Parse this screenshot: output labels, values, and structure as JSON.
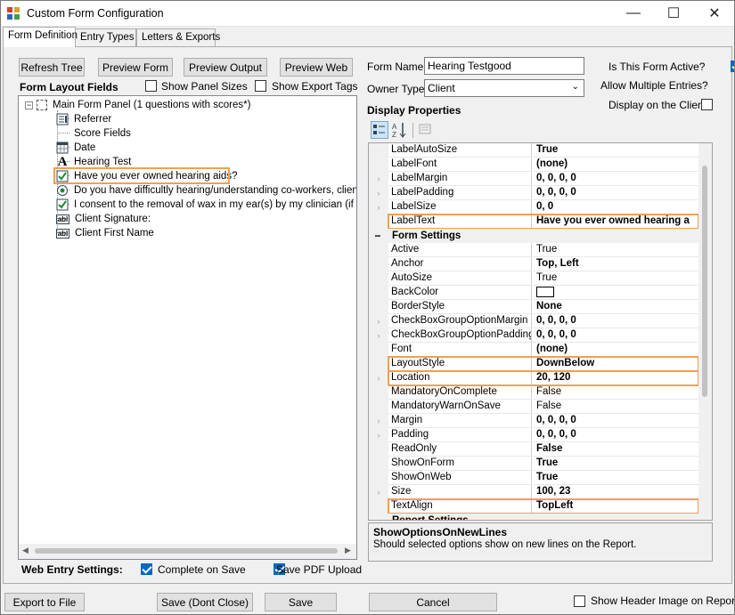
{
  "window": {
    "title": "Custom Form Configuration",
    "minimize_glyph": "—",
    "maximize_glyph": "☐",
    "close_glyph": "✕"
  },
  "tabs": [
    {
      "label": "Form Definition",
      "active": true
    },
    {
      "label": "Entry Types",
      "active": false
    },
    {
      "label": "Letters & Exports",
      "active": false
    }
  ],
  "toolbar": {
    "refresh_tree": "Refresh Tree",
    "preview_form": "Preview Form",
    "preview_output": "Preview Output",
    "preview_web": "Preview Web"
  },
  "layout_fields": {
    "heading": "Form Layout Fields",
    "show_panel_sizes": {
      "label": "Show Panel Sizes",
      "checked": false
    },
    "show_export_tags": {
      "label": "Show Export Tags",
      "checked": false
    }
  },
  "tree": {
    "root": "Main Form Panel (1 questions with scores*)",
    "items": [
      {
        "label": "Referrer",
        "icon": "dropdown-list-icon"
      },
      {
        "label": "Score Fields",
        "icon": "none"
      },
      {
        "label": "Date",
        "icon": "calendar-icon"
      },
      {
        "label": "Hearing Test",
        "icon": "text-label-icon"
      },
      {
        "label": "Have you ever owned hearing aids?",
        "icon": "checkbox-icon",
        "selected": true
      },
      {
        "label": "Do you have difficultly hearing/understanding co-workers, clients o",
        "icon": "radio-icon"
      },
      {
        "label": "I consent to the removal of wax in my ear(s) by my clinician (if applic",
        "icon": "checkbox-icon"
      },
      {
        "label": "Client Signature:",
        "icon": "textbox-icon"
      },
      {
        "label": "Client First Name",
        "icon": "textbox-icon"
      }
    ]
  },
  "web_entry": {
    "heading": "Web Entry Settings:",
    "complete_on_save": {
      "label": "Complete on Save",
      "checked": true
    },
    "save_pdf_upload": {
      "label": "Save PDF Upload",
      "checked": true
    }
  },
  "form": {
    "name_label": "Form Name",
    "name_value": "Hearing Testgood",
    "owner_label": "Owner Type",
    "owner_value": "Client",
    "is_active": {
      "label": "Is This Form Active?",
      "checked": true
    },
    "allow_multiple": {
      "label": "Allow Multiple Entries?",
      "checked": true
    },
    "display_client": {
      "label": "Display on the Client",
      "checked": false
    }
  },
  "display_properties": {
    "heading": "Display Properties",
    "rows": [
      {
        "name": "LabelAutoSize",
        "value": "True",
        "bold": true,
        "expandable": false
      },
      {
        "name": "LabelFont",
        "value": "(none)",
        "bold": true,
        "expandable": false
      },
      {
        "name": "LabelMargin",
        "value": "0, 0, 0, 0",
        "bold": true,
        "expandable": true
      },
      {
        "name": "LabelPadding",
        "value": "0, 0, 0, 0",
        "bold": true,
        "expandable": true
      },
      {
        "name": "LabelSize",
        "value": "0, 0",
        "bold": true,
        "expandable": true
      },
      {
        "name": "LabelText",
        "value": "Have you ever owned hearing a",
        "bold": true,
        "expandable": false,
        "highlight": true
      },
      {
        "category": "Form Settings"
      },
      {
        "name": "Active",
        "value": "True",
        "bold": false,
        "expandable": false
      },
      {
        "name": "Anchor",
        "value": "Top, Left",
        "bold": true,
        "expandable": false
      },
      {
        "name": "AutoSize",
        "value": "True",
        "bold": false,
        "expandable": false
      },
      {
        "name": "BackColor",
        "value": "",
        "bold": false,
        "expandable": false,
        "swatch": "#ffffff"
      },
      {
        "name": "BorderStyle",
        "value": "None",
        "bold": true,
        "expandable": false
      },
      {
        "name": "CheckBoxGroupOptionMargin",
        "value": "0, 0, 0, 0",
        "bold": true,
        "expandable": true
      },
      {
        "name": "CheckBoxGroupOptionPadding",
        "value": "0, 0, 0, 0",
        "bold": true,
        "expandable": true
      },
      {
        "name": "Font",
        "value": "(none)",
        "bold": true,
        "expandable": false
      },
      {
        "name": "LayoutStyle",
        "value": "DownBelow",
        "bold": true,
        "expandable": false,
        "highlight": true
      },
      {
        "name": "Location",
        "value": "20, 120",
        "bold": true,
        "expandable": true,
        "highlight": true
      },
      {
        "name": "MandatoryOnComplete",
        "value": "False",
        "bold": false,
        "expandable": false
      },
      {
        "name": "MandatoryWarnOnSave",
        "value": "False",
        "bold": false,
        "expandable": false
      },
      {
        "name": "Margin",
        "value": "0, 0, 0, 0",
        "bold": true,
        "expandable": true
      },
      {
        "name": "Padding",
        "value": "0, 0, 0, 0",
        "bold": true,
        "expandable": true
      },
      {
        "name": "ReadOnly",
        "value": "False",
        "bold": true,
        "expandable": false
      },
      {
        "name": "ShowOnForm",
        "value": "True",
        "bold": true,
        "expandable": false
      },
      {
        "name": "ShowOnWeb",
        "value": "True",
        "bold": true,
        "expandable": false
      },
      {
        "name": "Size",
        "value": "100, 23",
        "bold": true,
        "expandable": true
      },
      {
        "name": "TextAlign",
        "value": "TopLeft",
        "bold": true,
        "expandable": false,
        "highlight": true
      },
      {
        "category": "Report Settings"
      }
    ],
    "help_title": "ShowOptionsOnNewLines",
    "help_text": "Should selected options show on new lines on the Report."
  },
  "footer": {
    "export_to_file": "Export to File",
    "save_dont_close": "Save (Dont Close)",
    "save": "Save",
    "cancel": "Cancel",
    "show_header_image": {
      "label": "Show Header Image on Report?",
      "checked": false
    }
  },
  "colors": {
    "accent": "#0067c0",
    "highlight": "#f0a050"
  }
}
